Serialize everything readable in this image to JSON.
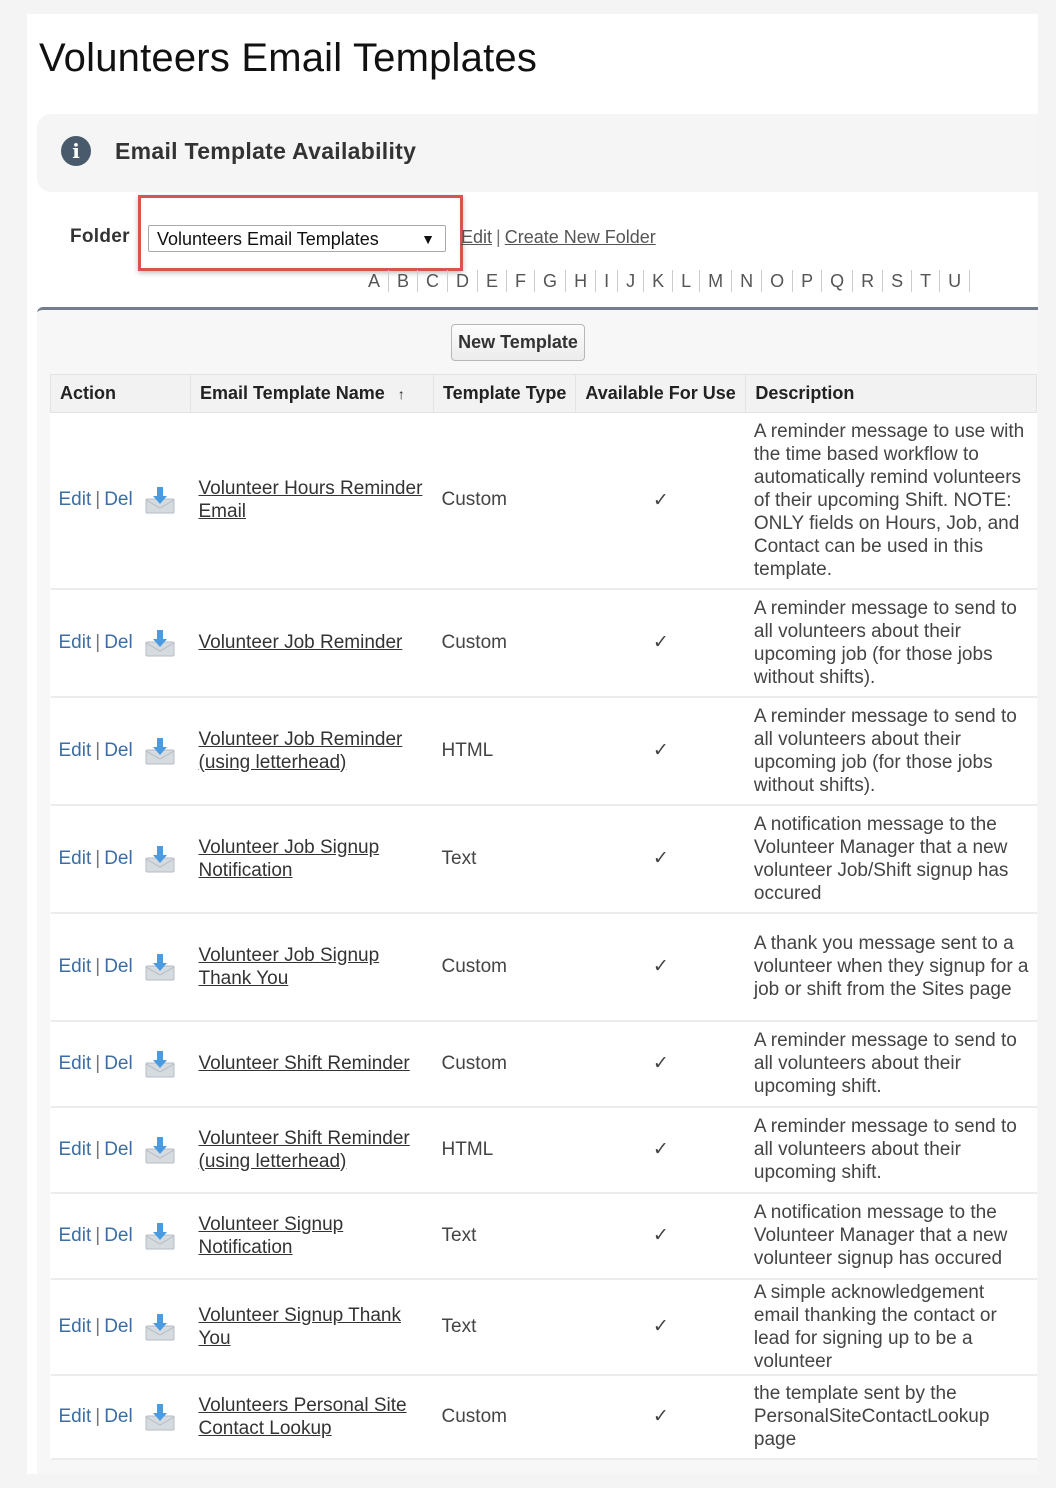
{
  "page": {
    "title": "Volunteers Email Templates",
    "info_banner": {
      "icon": "info-icon",
      "text": "Email Template Availability"
    }
  },
  "folder": {
    "label": "Folder",
    "selected": "Volunteers Email Templates",
    "edit_link": "Edit",
    "separator": "|",
    "create_link": "Create New Folder"
  },
  "alphabet": [
    "A",
    "B",
    "C",
    "D",
    "E",
    "F",
    "G",
    "H",
    "I",
    "J",
    "K",
    "L",
    "M",
    "N",
    "O",
    "P",
    "Q",
    "R",
    "S",
    "T",
    "U"
  ],
  "list": {
    "new_button": "New Template",
    "columns": [
      "Action",
      "Email Template Name",
      "Template Type",
      "Available For Use",
      "Description"
    ],
    "sort_indicator": "↑",
    "edit_label": "Edit",
    "del_label": "Del",
    "check_glyph": "✓",
    "rows": [
      {
        "name": "Volunteer Hours Reminder Email",
        "type": "Custom",
        "available": true,
        "description": "A reminder message to use with the time based workflow to automatically remind volunteers of their upcoming Shift. NOTE: ONLY fields on Hours, Job, and Contact can be used in this template."
      },
      {
        "name": "Volunteer Job Reminder",
        "type": "Custom",
        "available": true,
        "description": "A reminder message to send to all volunteers about their upcoming job (for those jobs without shifts)."
      },
      {
        "name": "Volunteer Job Reminder (using letterhead)",
        "type": "HTML",
        "available": true,
        "description": "A reminder message to send to all volunteers about their upcoming job (for those jobs without shifts)."
      },
      {
        "name": "Volunteer Job Signup Notification",
        "type": "Text",
        "available": true,
        "description": "A notification message to the Volunteer Manager that a new volunteer Job/Shift signup has occured"
      },
      {
        "name": "Volunteer Job Signup Thank You",
        "type": "Custom",
        "available": true,
        "description": "A thank you message sent to a volunteer when they signup for a job or shift from the Sites page"
      },
      {
        "name": "Volunteer Shift Reminder",
        "type": "Custom",
        "available": true,
        "description": "A reminder message to send to all volunteers about their upcoming shift."
      },
      {
        "name": "Volunteer Shift Reminder (using letterhead)",
        "type": "HTML",
        "available": true,
        "description": "A reminder message to send to all volunteers about their upcoming shift."
      },
      {
        "name": "Volunteer Signup Notification",
        "type": "Text",
        "available": true,
        "description": "A notification message to the Volunteer Manager that a new volunteer signup has occured"
      },
      {
        "name": "Volunteer Signup Thank You",
        "type": "Text",
        "available": true,
        "description": "A simple acknowledgement email thanking the contact or lead for signing up to be a volunteer"
      },
      {
        "name": "Volunteers Personal Site Contact Lookup",
        "type": "Custom",
        "available": true,
        "description": "the template sent by the PersonalSiteContactLookup page"
      }
    ]
  },
  "colors": {
    "link_blue": "#3c6ea5",
    "highlight_red": "#d9534f",
    "panel_border": "#737d8c",
    "info_icon_bg": "#4a5a6d"
  }
}
